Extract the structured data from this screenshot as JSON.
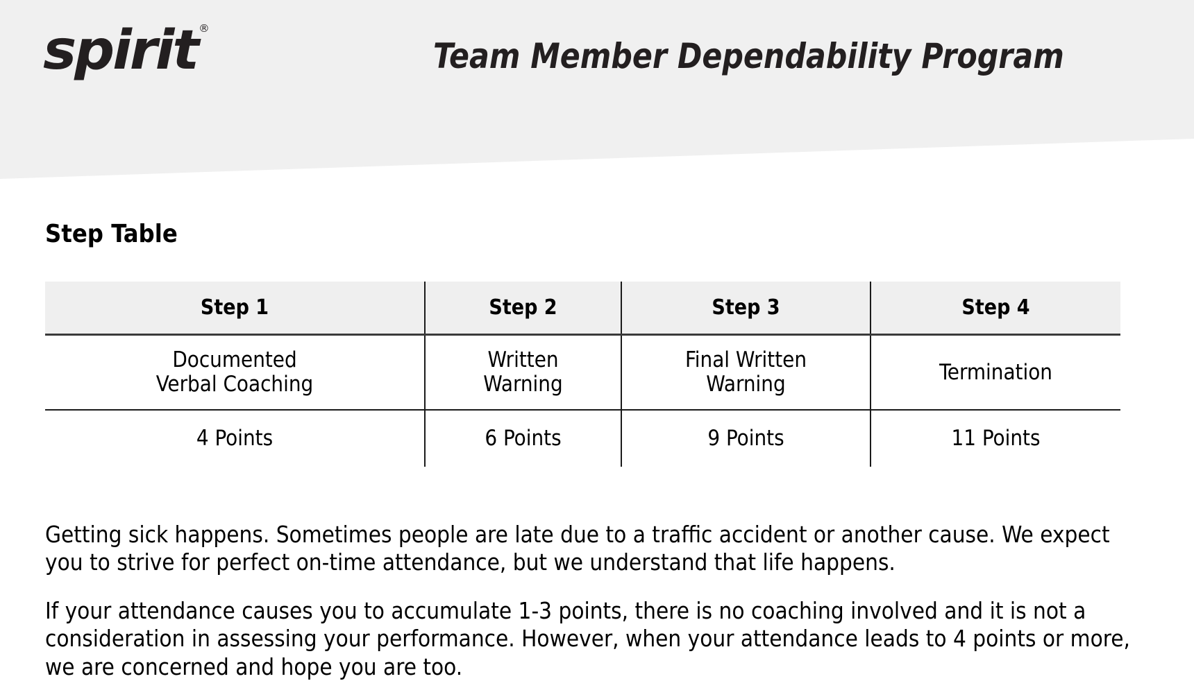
{
  "header": {
    "logo_text": "spirit",
    "logo_trademark": "®",
    "program_title": "Team Member Dependability Program",
    "band_color": "#f0f0f0",
    "text_color": "#231f20"
  },
  "section": {
    "heading": "Step Table"
  },
  "step_table": {
    "columns": [
      "Step 1",
      "Step 2",
      "Step 3",
      "Step 4"
    ],
    "rows": [
      {
        "name": "action",
        "cells": [
          "Documented\nVerbal Coaching",
          "Written\nWarning",
          "Final Written\nWarning",
          "Termination"
        ]
      },
      {
        "name": "points",
        "cells": [
          "4 Points",
          "6 Points",
          "9 Points",
          "11 Points"
        ]
      }
    ],
    "cells": {
      "step1_action_line1": "Documented",
      "step1_action_line2": "Verbal Coaching",
      "step2_action_line1": "Written",
      "step2_action_line2": "Warning",
      "step3_action_line1": "Final Written",
      "step3_action_line2": "Warning",
      "step4_action_line1": "Termination",
      "step1_points": "4 Points",
      "step2_points": "6 Points",
      "step3_points": "9 Points",
      "step4_points": "11 Points"
    },
    "header_bg": "#efefef",
    "border_color": "#1a1a1a"
  },
  "body": {
    "paragraph_1": "Getting sick happens. Sometimes people are late due to a traffic accident or another cause. We expect you to strive for perfect on-time attendance, but we understand that life happens.",
    "paragraph_2": "If your attendance causes you to accumulate 1-3 points, there is no coaching involved and it is not a consideration in assessing your performance. However, when your attendance leads to 4 points or more, we are concerned and hope you are too."
  }
}
